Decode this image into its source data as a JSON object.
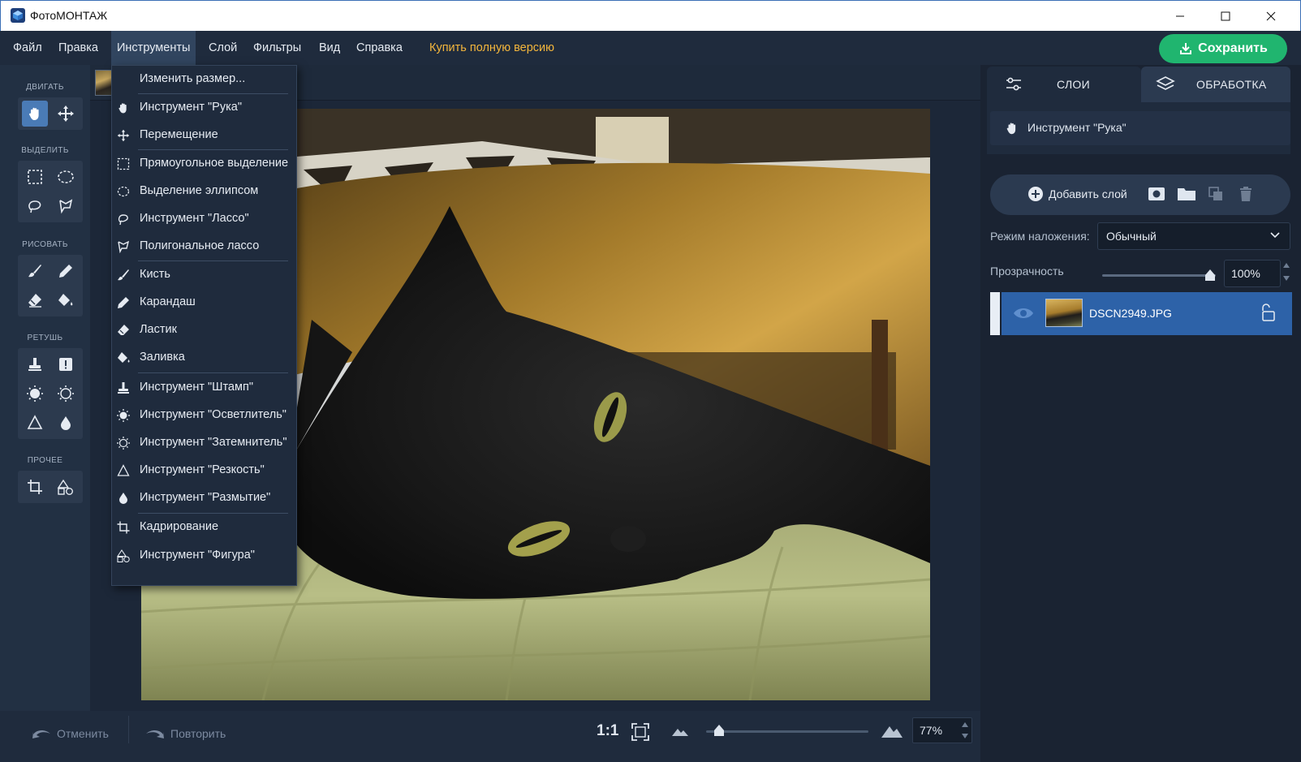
{
  "window": {
    "title": "ФотоМОНТАЖ"
  },
  "menubar": {
    "items": [
      {
        "id": "file",
        "label": "Файл"
      },
      {
        "id": "edit",
        "label": "Правка"
      },
      {
        "id": "tools",
        "label": "Инструменты"
      },
      {
        "id": "layer",
        "label": "Слой"
      },
      {
        "id": "filters",
        "label": "Фильтры"
      },
      {
        "id": "view",
        "label": "Вид"
      },
      {
        "id": "help",
        "label": "Справка"
      }
    ],
    "buy_label": "Купить полную версию",
    "save_label": "Сохранить"
  },
  "toolbar": {
    "sections": [
      {
        "label": "ДВИГАТЬ",
        "tools": [
          "hand-icon",
          "move-icon"
        ]
      },
      {
        "label": "ВЫДЕЛИТЬ",
        "tools": [
          "rect-select-icon",
          "ellipse-select-icon",
          "lasso-icon",
          "polygon-lasso-icon"
        ]
      },
      {
        "label": "РИСОВАТЬ",
        "tools": [
          "brush-icon",
          "pencil-icon",
          "eraser-icon",
          "fill-icon"
        ]
      },
      {
        "label": "РЕТУШЬ",
        "tools": [
          "stamp-icon",
          "patch-icon",
          "dodge-icon",
          "burn-icon",
          "sharpen-icon",
          "blur-icon"
        ]
      },
      {
        "label": "ПРОЧЕЕ",
        "tools": [
          "crop-icon",
          "shape-icon"
        ]
      }
    ],
    "selected_tool": "hand-icon"
  },
  "tools_menu": {
    "items": [
      {
        "label": "Изменить размер...",
        "icon": ""
      },
      {
        "label": "Инструмент \"Рука\"",
        "icon": "hand-icon"
      },
      {
        "label": "Перемещение",
        "icon": "move-icon"
      },
      {
        "label": "Прямоугольное выделение",
        "icon": "rect-select-icon"
      },
      {
        "label": "Выделение эллипсом",
        "icon": "ellipse-select-icon"
      },
      {
        "label": "Инструмент \"Лассо\"",
        "icon": "lasso-icon"
      },
      {
        "label": "Полигональное лассо",
        "icon": "polygon-lasso-icon"
      },
      {
        "label": "Кисть",
        "icon": "brush-icon"
      },
      {
        "label": "Карандаш",
        "icon": "pencil-icon"
      },
      {
        "label": "Ластик",
        "icon": "eraser-icon"
      },
      {
        "label": "Заливка",
        "icon": "fill-icon"
      },
      {
        "label": "Инструмент \"Штамп\"",
        "icon": "stamp-icon"
      },
      {
        "label": "Инструмент \"Осветлитель\"",
        "icon": "dodge-icon"
      },
      {
        "label": "Инструмент \"Затемнитель\"",
        "icon": "burn-icon"
      },
      {
        "label": "Инструмент \"Резкость\"",
        "icon": "sharpen-icon"
      },
      {
        "label": "Инструмент \"Размытие\"",
        "icon": "blur-icon"
      },
      {
        "label": "Кадрирование",
        "icon": "crop-icon"
      },
      {
        "label": "Инструмент \"Фигура\"",
        "icon": "shape-icon"
      }
    ]
  },
  "bottombar": {
    "undo_label": "Отменить",
    "redo_label": "Повторить",
    "actual_size_label": "1:1",
    "zoom_value": "77%",
    "zoom_level": 0.08
  },
  "right_panel": {
    "tabs": [
      {
        "label": "СЛОИ",
        "icon": "sliders-icon",
        "active": true
      },
      {
        "label": "ОБРАБОТКА",
        "icon": "layers-icon",
        "active": false
      }
    ],
    "current_tool_label": "Инструмент \"Рука\"",
    "add_layer_label": "Добавить слой",
    "blend_mode_label": "Режим наложения:",
    "blend_mode_value": "Обычный",
    "opacity_label": "Прозрачность",
    "opacity_value": "100%",
    "opacity_level": 1.0,
    "layers": [
      {
        "name": "DSCN2949.JPG",
        "visible": true,
        "selected": true
      }
    ]
  },
  "colors": {
    "accent": "#20b56f",
    "buy_link": "#f4b63c",
    "selection": "#2d62a8",
    "panel_bg": "#1f2b3d"
  }
}
